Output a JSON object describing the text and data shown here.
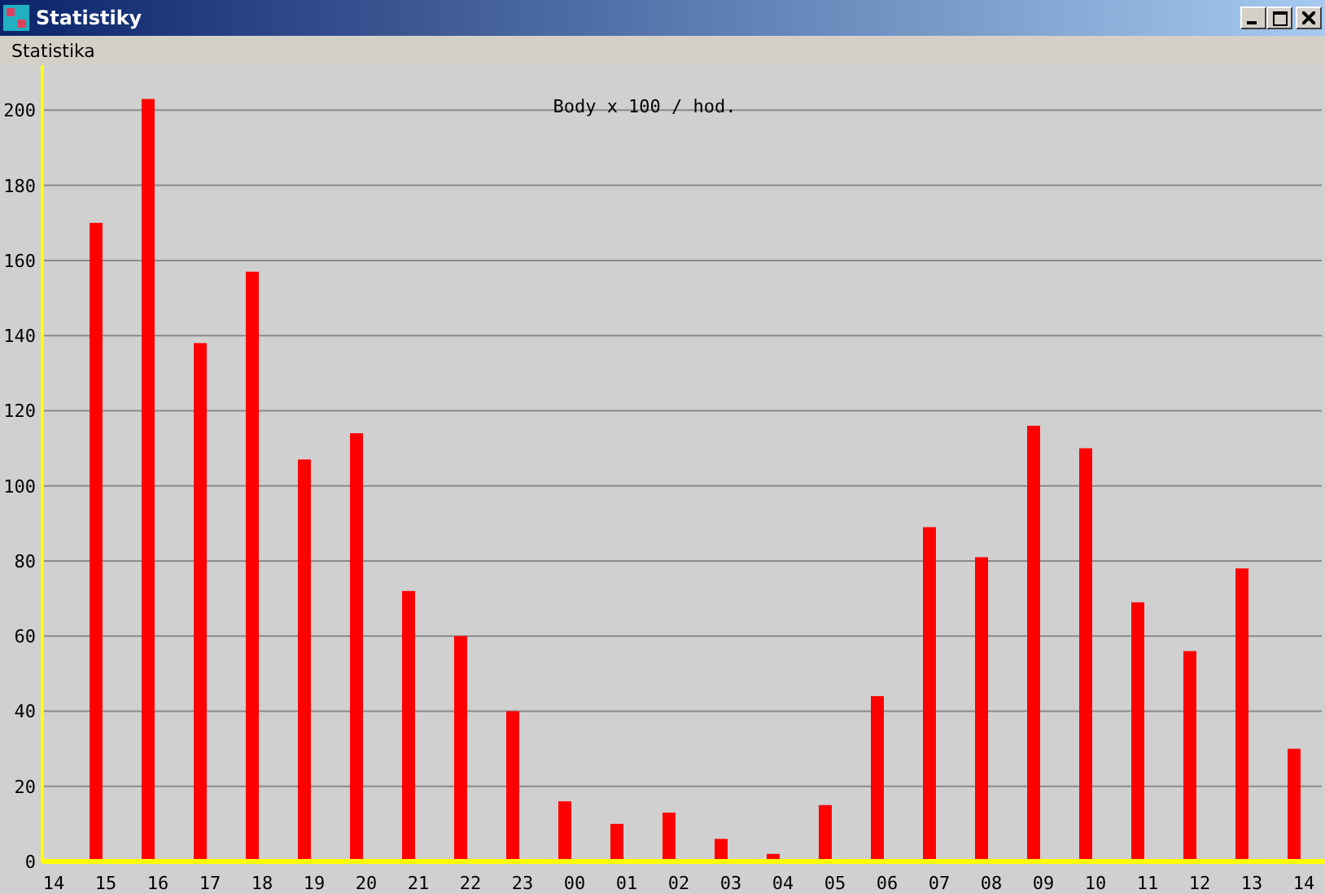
{
  "window": {
    "title": "Statistiky"
  },
  "menu": [
    "Statistika"
  ],
  "chart": {
    "chart_data": {
      "type": "bar",
      "title": "Body x 100 / hod.",
      "categories": [
        "14",
        "15",
        "16",
        "17",
        "18",
        "19",
        "20",
        "21",
        "22",
        "23",
        "00",
        "01",
        "02",
        "03",
        "04",
        "05",
        "06",
        "07",
        "08",
        "09",
        "10",
        "11",
        "12",
        "13",
        "14"
      ],
      "grid": true,
      "series": [
        {
          "color": "#ff0000",
          "values": [
            null,
            170,
            203,
            138,
            157,
            107,
            114,
            72,
            60,
            40,
            16,
            10,
            13,
            6,
            2,
            15,
            44,
            89,
            81,
            116,
            110,
            69,
            56,
            78,
            30
          ]
        }
      ],
      "ylim": [
        0,
        212
      ],
      "yticks": [
        0,
        20,
        40,
        60,
        80,
        100,
        120,
        140,
        160,
        180,
        200
      ]
    }
  }
}
